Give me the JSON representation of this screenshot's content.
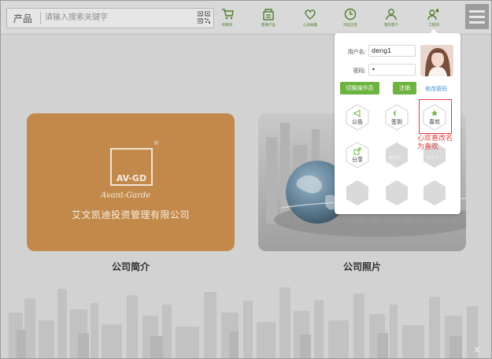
{
  "search": {
    "category": "产品",
    "placeholder": "请输入搜索关键字"
  },
  "nav": [
    {
      "label": "购物车",
      "icon": "cart-icon"
    },
    {
      "label": "需要产品",
      "icon": "building-icon"
    },
    {
      "label": "心动收藏",
      "icon": "heart-icon"
    },
    {
      "label": "浏览历史",
      "icon": "clock-icon"
    },
    {
      "label": "我的客户",
      "icon": "user-icon"
    },
    {
      "label": "工程师",
      "icon": "user-speaker-icon"
    }
  ],
  "cards": {
    "intro": {
      "caption": "公司简介",
      "logo_text": "AV-GD",
      "logo_reg": "®",
      "logo_script": "Avant-Garde",
      "company_name": "艾文凯迪投资管理有限公司"
    },
    "photos": {
      "caption": "公司照片"
    }
  },
  "popup": {
    "username_label": "用户名:",
    "username_value": "deng1",
    "password_label": "密码:",
    "password_value": "•",
    "switch_operator": "切换操作员",
    "logout": "注销",
    "change_password": "修改密码",
    "tiles": [
      {
        "label": "公告",
        "icon": "megaphone-icon",
        "active": true
      },
      {
        "label": "签到",
        "icon": "moon-icon",
        "active": true
      },
      {
        "label": "喜欢",
        "icon": "star-icon",
        "active": true
      },
      {
        "label": "分享",
        "icon": "share-icon",
        "active": true
      },
      {
        "label": "施工中...",
        "active": false
      },
      {
        "label": "施工中...",
        "active": false
      },
      {
        "label": "",
        "active": false
      },
      {
        "label": "",
        "active": false
      },
      {
        "label": "",
        "active": false
      }
    ],
    "annotation": "心欢喜改名为喜欢"
  },
  "close_mark": "×",
  "colors": {
    "accent_green": "#6db33f",
    "annotation_red": "#e23b3b",
    "card_orange": "#c3894b"
  }
}
